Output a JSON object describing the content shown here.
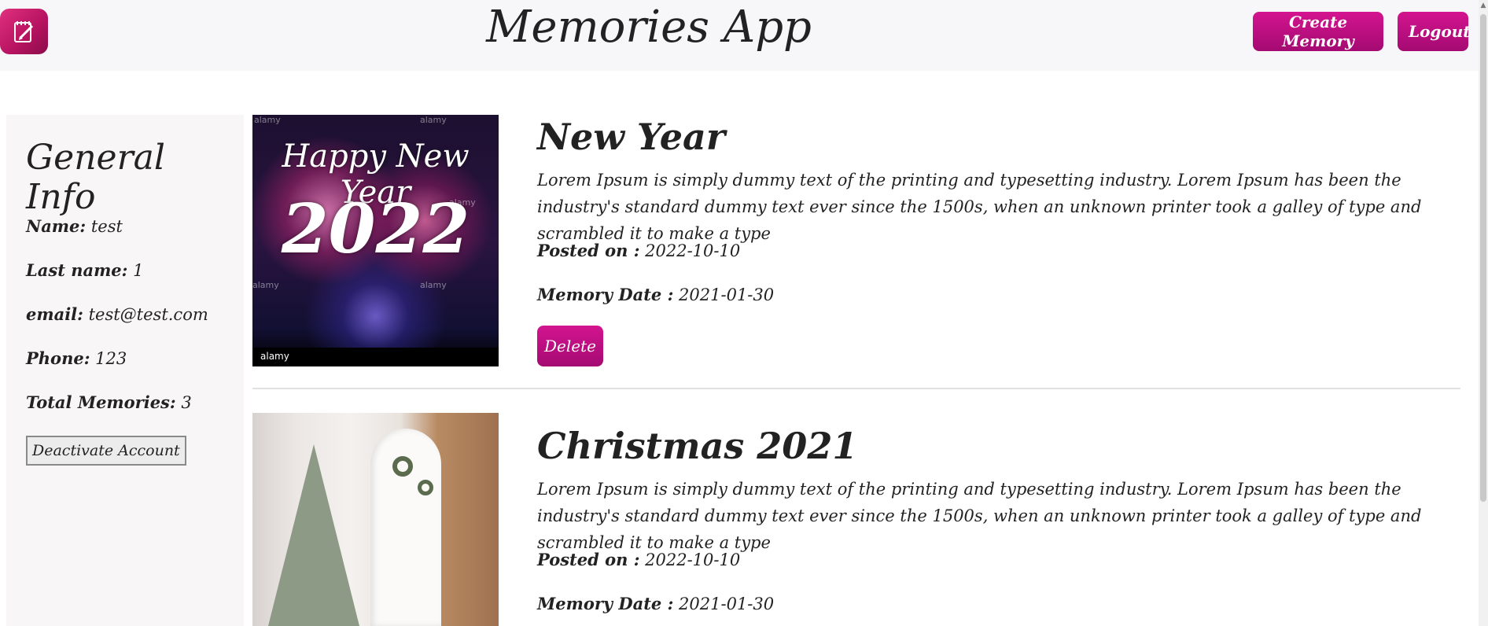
{
  "header": {
    "title": "Memories App",
    "create_label": "Create Memory",
    "logout_label": "Logout",
    "logo_icon": "notepad-pencil-icon",
    "accent_color": "#c2127f"
  },
  "sidebar": {
    "title": "General Info",
    "fields": [
      {
        "label": "Name:",
        "value": "test"
      },
      {
        "label": "Last name:",
        "value": "1"
      },
      {
        "label": "email:",
        "value": "test@test.com"
      },
      {
        "label": "Phone:",
        "value": "123"
      },
      {
        "label": "Total Memories:",
        "value": "3"
      }
    ],
    "deactivate_label": "Deactivate Account"
  },
  "memories": [
    {
      "title": "New Year",
      "description": "Lorem Ipsum is simply dummy text of the printing and typesetting industry. Lorem Ipsum has been the industry's standard dummy text ever since the 1500s, when an unknown printer took a galley of type and scrambled it to make a type",
      "posted_label": "Posted on :",
      "posted_value": "2022-10-10",
      "memory_date_label": "Memory Date :",
      "memory_date_value": "2021-01-30",
      "delete_label": "Delete",
      "image_text_1": "Happy New Year",
      "image_text_2": "2022",
      "image_watermark": "alamy"
    },
    {
      "title": "Christmas 2021",
      "description": "Lorem Ipsum is simply dummy text of the printing and typesetting industry. Lorem Ipsum has been the industry's standard dummy text ever since the 1500s, when an unknown printer took a galley of type and scrambled it to make a type",
      "posted_label": "Posted on :",
      "posted_value": "2022-10-10",
      "memory_date_label": "Memory Date :",
      "memory_date_value": "2021-01-30"
    }
  ]
}
